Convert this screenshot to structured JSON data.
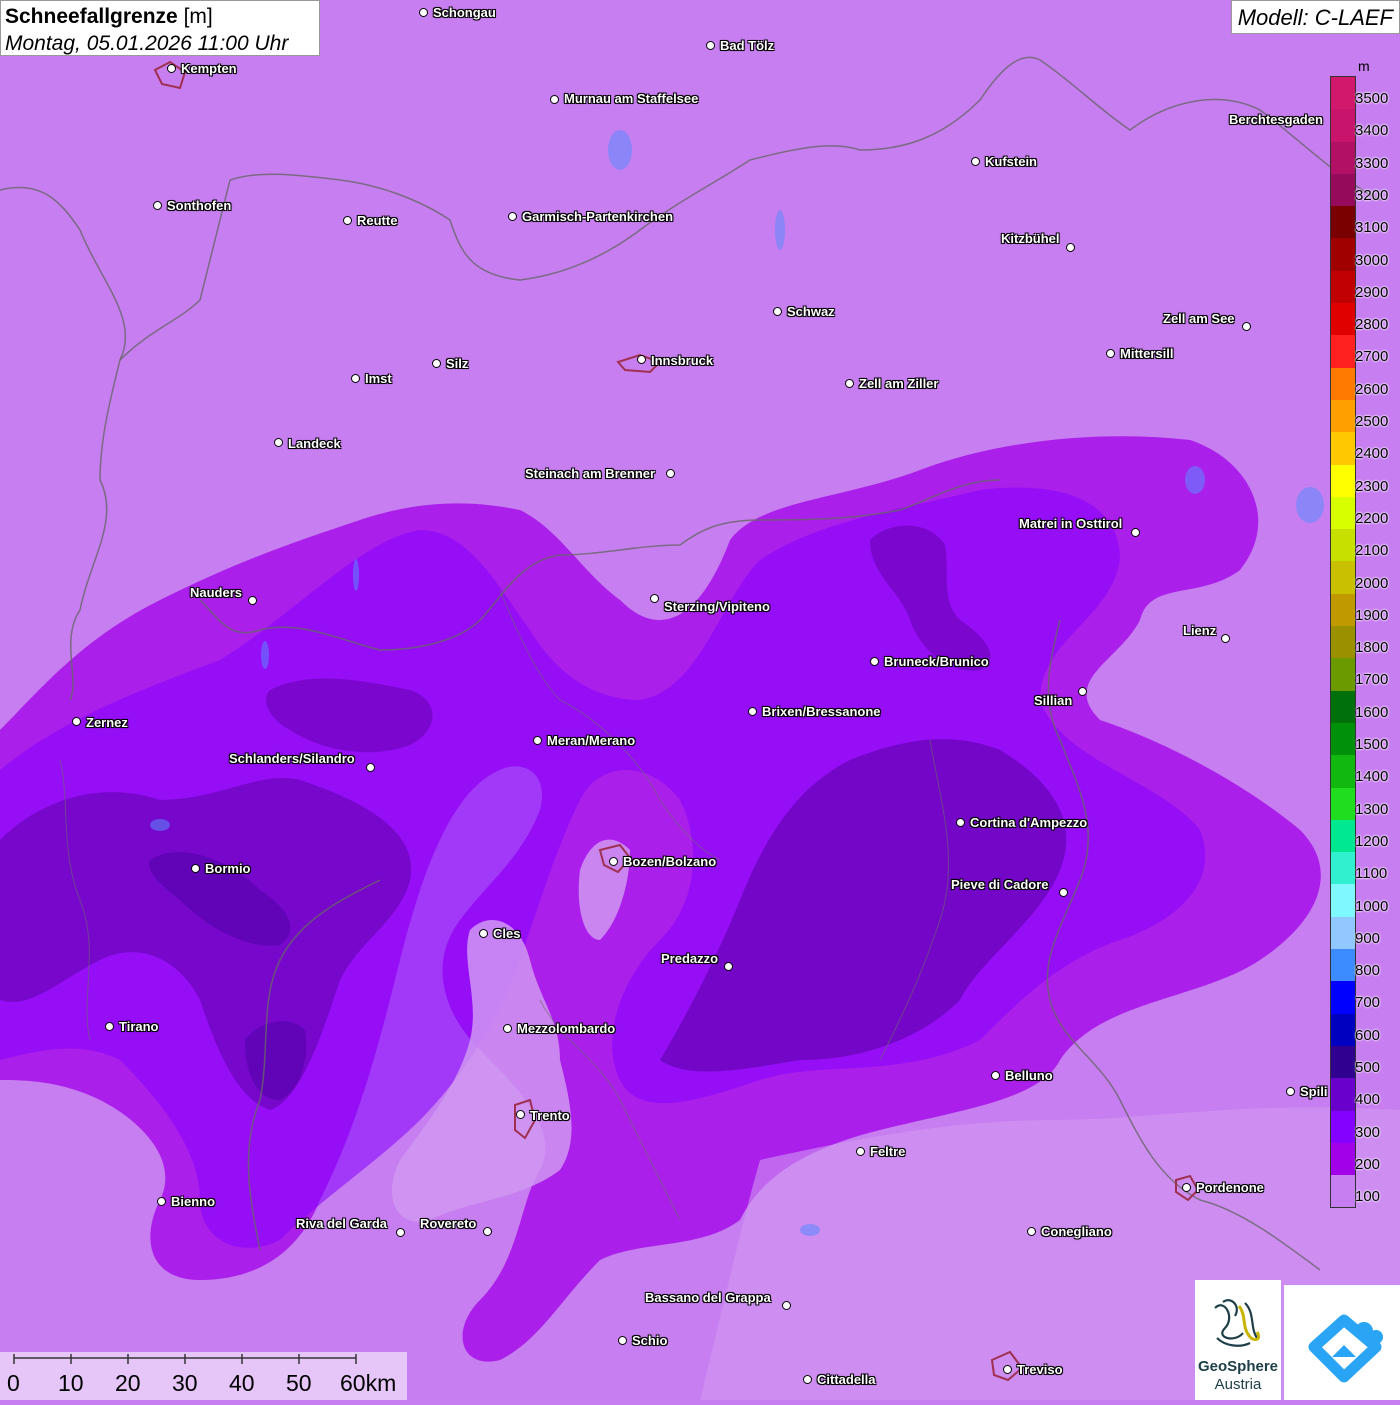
{
  "title": {
    "main": "Schneefallgrenze",
    "unit": "[m]",
    "datetime": "Montag, 05.01.2026 11:00 Uhr"
  },
  "model": "Modell: C-LAEF",
  "legend": {
    "unit": "m",
    "levels": [
      {
        "value": "3500",
        "color": "#d2186c"
      },
      {
        "value": "3400",
        "color": "#c8146a"
      },
      {
        "value": "3300",
        "color": "#b21064"
      },
      {
        "value": "3200",
        "color": "#960a5c"
      },
      {
        "value": "3100",
        "color": "#7a0000"
      },
      {
        "value": "3000",
        "color": "#a00000"
      },
      {
        "value": "2900",
        "color": "#c00000"
      },
      {
        "value": "2800",
        "color": "#e00000"
      },
      {
        "value": "2700",
        "color": "#ff2020"
      },
      {
        "value": "2600",
        "color": "#ff7a00"
      },
      {
        "value": "2500",
        "color": "#ffa000"
      },
      {
        "value": "2400",
        "color": "#ffc800"
      },
      {
        "value": "2300",
        "color": "#ffff00"
      },
      {
        "value": "2200",
        "color": "#d8ff00"
      },
      {
        "value": "2100",
        "color": "#c8e000"
      },
      {
        "value": "2000",
        "color": "#c8c000"
      },
      {
        "value": "1900",
        "color": "#c09800"
      },
      {
        "value": "1800",
        "color": "#9a9000"
      },
      {
        "value": "1700",
        "color": "#6a9a00"
      },
      {
        "value": "1600",
        "color": "#00700a"
      },
      {
        "value": "1500",
        "color": "#00900a"
      },
      {
        "value": "1400",
        "color": "#10b810"
      },
      {
        "value": "1300",
        "color": "#20dd20"
      },
      {
        "value": "1200",
        "color": "#00e890"
      },
      {
        "value": "1100",
        "color": "#30f0d0"
      },
      {
        "value": "1000",
        "color": "#80f8ff"
      },
      {
        "value": "900",
        "color": "#90c8ff"
      },
      {
        "value": "800",
        "color": "#3c8cff"
      },
      {
        "value": "700",
        "color": "#0000ff"
      },
      {
        "value": "600",
        "color": "#0000c0"
      },
      {
        "value": "500",
        "color": "#300090"
      },
      {
        "value": "400",
        "color": "#6a00cc"
      },
      {
        "value": "300",
        "color": "#8400ff"
      },
      {
        "value": "200",
        "color": "#a200e8"
      },
      {
        "value": "100",
        "color": "#c77ef0"
      }
    ]
  },
  "cities": [
    {
      "name": "Schongau"
    },
    {
      "name": "Kempten"
    },
    {
      "name": "Bad Tölz"
    },
    {
      "name": "Murnau am Staffelsee"
    },
    {
      "name": "Berchtesgaden"
    },
    {
      "name": "Kufstein"
    },
    {
      "name": "Sonthofen"
    },
    {
      "name": "Reutte"
    },
    {
      "name": "Garmisch-Partenkirchen"
    },
    {
      "name": "Kitzbühel"
    },
    {
      "name": "Schwaz"
    },
    {
      "name": "Zell am See"
    },
    {
      "name": "Mittersill"
    },
    {
      "name": "Imst"
    },
    {
      "name": "Silz"
    },
    {
      "name": "Innsbruck"
    },
    {
      "name": "Zell am Ziller"
    },
    {
      "name": "Landeck"
    },
    {
      "name": "Steinach am Brenner"
    },
    {
      "name": "Matrei in Osttirol"
    },
    {
      "name": "Nauders"
    },
    {
      "name": "Sterzing/Vipiteno"
    },
    {
      "name": "Lienz"
    },
    {
      "name": "Bruneck/Brunico"
    },
    {
      "name": "Sillian"
    },
    {
      "name": "Zernez"
    },
    {
      "name": "Brixen/Bressanone"
    },
    {
      "name": "Schlanders/Silandro"
    },
    {
      "name": "Meran/Merano"
    },
    {
      "name": "Cortina d'Ampezzo"
    },
    {
      "name": "Bormio"
    },
    {
      "name": "Bozen/Bolzano"
    },
    {
      "name": "Pieve di Cadore"
    },
    {
      "name": "Cles"
    },
    {
      "name": "Predazzo"
    },
    {
      "name": "Tirano"
    },
    {
      "name": "Mezzolombardo"
    },
    {
      "name": "Belluno"
    },
    {
      "name": "Spili"
    },
    {
      "name": "Trento"
    },
    {
      "name": "Feltre"
    },
    {
      "name": "Pordenone"
    },
    {
      "name": "Bienno"
    },
    {
      "name": "Riva del Garda"
    },
    {
      "name": "Rovereto"
    },
    {
      "name": "Conegliano"
    },
    {
      "name": "Bassano del Grappa"
    },
    {
      "name": "Schio"
    },
    {
      "name": "Treviso"
    },
    {
      "name": "Cittadella"
    }
  ],
  "scalebar": {
    "ticks": [
      "0",
      "10",
      "20",
      "30",
      "40",
      "50",
      "60km"
    ]
  },
  "logos": {
    "geosphere_line1": "GeoSphere",
    "geosphere_line2": "Austria"
  }
}
